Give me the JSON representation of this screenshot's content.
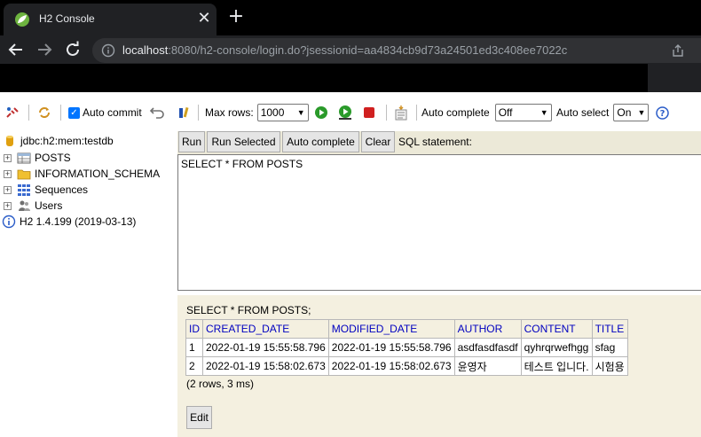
{
  "browser": {
    "tab_title": "H2 Console",
    "tab_close": "✕",
    "new_tab": "+",
    "url_host": "localhost",
    "url_rest": ":8080/h2-console/login.do?jsessionid=aa4834cb9d73a24501ed3c408ee7022c"
  },
  "toolbar": {
    "auto_commit_label": "Auto commit",
    "max_rows_label": "Max rows:",
    "max_rows_value": "1000",
    "auto_complete_label": "Auto complete",
    "auto_complete_value": "Off",
    "auto_select_label": "Auto select",
    "auto_select_value": "On"
  },
  "tree": {
    "connection": "jdbc:h2:mem:testdb",
    "items": [
      {
        "label": "POSTS",
        "icon": "table-icon"
      },
      {
        "label": "INFORMATION_SCHEMA",
        "icon": "folder-icon"
      },
      {
        "label": "Sequences",
        "icon": "sequences-icon"
      },
      {
        "label": "Users",
        "icon": "users-icon"
      }
    ],
    "version": "H2 1.4.199 (2019-03-13)"
  },
  "sql": {
    "run_label": "Run",
    "run_selected_label": "Run Selected",
    "auto_complete_label": "Auto complete",
    "clear_label": "Clear",
    "statement_label": "SQL statement:",
    "statement_text": "SELECT * FROM POSTS"
  },
  "results": {
    "query": "SELECT * FROM POSTS;",
    "columns": [
      "ID",
      "CREATED_DATE",
      "MODIFIED_DATE",
      "AUTHOR",
      "CONTENT",
      "TITLE"
    ],
    "rows": [
      [
        "1",
        "2022-01-19 15:55:58.796",
        "2022-01-19 15:55:58.796",
        "asdfasdfasdf",
        "qyhrqrwefhgg",
        "sfag"
      ],
      [
        "2",
        "2022-01-19 15:58:02.673",
        "2022-01-19 15:58:02.673",
        "윤영자",
        "테스트 입니다.",
        "시험용"
      ]
    ],
    "count": "(2 rows, 3 ms)",
    "edit_label": "Edit"
  },
  "colors": {
    "header_blue": "#0000c0",
    "panel_beige": "#ece9d8",
    "chrome_dark": "#202124"
  }
}
